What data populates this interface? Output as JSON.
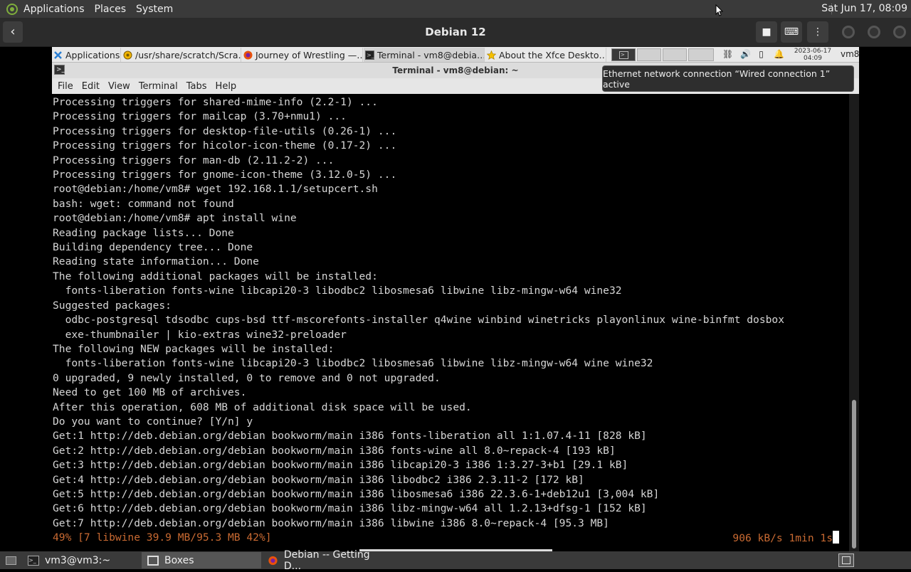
{
  "host_top": {
    "menus": [
      "Applications",
      "Places",
      "System"
    ],
    "clock": "Sat Jun 17, 08:09"
  },
  "boxes": {
    "title": "Debian 12"
  },
  "guest_panel": {
    "tasks": [
      "Applications",
      "/usr/share/scratch/Scra…",
      "Journey of Wrestling —…",
      "Terminal - vm8@debia…",
      "About the Xfce Deskto…"
    ],
    "date": "2023-06-17",
    "time": "04:09",
    "user": "vm8"
  },
  "terminal": {
    "title": "Terminal - vm8@debian: ~",
    "menu": [
      "File",
      "Edit",
      "View",
      "Terminal",
      "Tabs",
      "Help"
    ],
    "lines": [
      "Processing triggers for shared-mime-info (2.2-1) ...",
      "Processing triggers for mailcap (3.70+nmu1) ...",
      "Processing triggers for desktop-file-utils (0.26-1) ...",
      "Processing triggers for hicolor-icon-theme (0.17-2) ...",
      "Processing triggers for man-db (2.11.2-2) ...",
      "Processing triggers for gnome-icon-theme (3.12.0-5) ...",
      "root@debian:/home/vm8# wget 192.168.1.1/setupcert.sh",
      "bash: wget: command not found",
      "root@debian:/home/vm8# apt install wine",
      "Reading package lists... Done",
      "Building dependency tree... Done",
      "Reading state information... Done",
      "The following additional packages will be installed:",
      "  fonts-liberation fonts-wine libcapi20-3 libodbc2 libosmesa6 libwine libz-mingw-w64 wine32",
      "Suggested packages:",
      "  odbc-postgresql tdsodbc cups-bsd ttf-mscorefonts-installer q4wine winbind winetricks playonlinux wine-binfmt dosbox",
      "  exe-thumbnailer | kio-extras wine32-preloader",
      "The following NEW packages will be installed:",
      "  fonts-liberation fonts-wine libcapi20-3 libodbc2 libosmesa6 libwine libz-mingw-w64 wine wine32",
      "0 upgraded, 9 newly installed, 0 to remove and 0 not upgraded.",
      "Need to get 100 MB of archives.",
      "After this operation, 608 MB of additional disk space will be used.",
      "Do you want to continue? [Y/n] y",
      "Get:1 http://deb.debian.org/debian bookworm/main i386 fonts-liberation all 1:1.07.4-11 [828 kB]",
      "Get:2 http://deb.debian.org/debian bookworm/main i386 fonts-wine all 8.0~repack-4 [193 kB]",
      "Get:3 http://deb.debian.org/debian bookworm/main i386 libcapi20-3 i386 1:3.27-3+b1 [29.1 kB]",
      "Get:4 http://deb.debian.org/debian bookworm/main i386 libodbc2 i386 2.3.11-2 [172 kB]",
      "Get:5 http://deb.debian.org/debian bookworm/main i386 libosmesa6 i386 22.3.6-1+deb12u1 [3,004 kB]",
      "Get:6 http://deb.debian.org/debian bookworm/main i386 libz-mingw-w64 all 1.2.13+dfsg-1 [152 kB]",
      "Get:7 http://deb.debian.org/debian bookworm/main i386 libwine i386 8.0~repack-4 [95.3 MB]"
    ],
    "progress_left": "49% [7 libwine 39.9 MB/95.3 MB 42%]",
    "progress_right": "906 kB/s 1min 1s"
  },
  "notification": "Ethernet network connection “Wired connection 1” active",
  "host_bottom": {
    "items": [
      "vm3@vm3:~",
      "Boxes",
      "Debian -- Getting D..."
    ]
  }
}
